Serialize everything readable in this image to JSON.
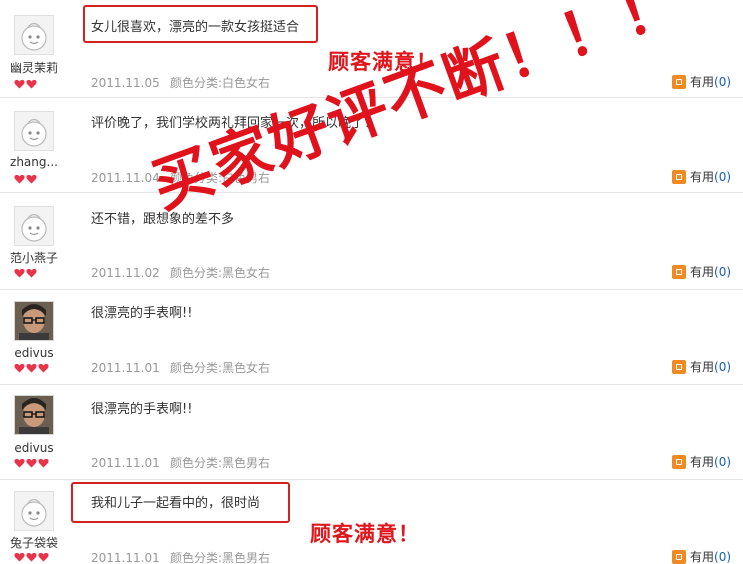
{
  "useful_label": "有用",
  "reviews": [
    {
      "user": "幽灵茉莉",
      "comment": "女儿很喜欢，漂亮的一款女孩挺适合",
      "date": "2011.11.05",
      "variant": "颜色分类:白色女右",
      "useful_count": "(0)",
      "avatar": "default-avatar",
      "hearts": 2
    },
    {
      "user": "zhang...",
      "comment": "评价晚了，我们学校两礼拜回家一次，所以晚了！",
      "date": "2011.11.04",
      "variant": "颜色分类:白色男右",
      "useful_count": "(0)",
      "avatar": "default-avatar",
      "hearts": 2
    },
    {
      "user": "范小燕子",
      "comment": "还不错，跟想象的差不多",
      "date": "2011.11.02",
      "variant": "颜色分类:黑色女右",
      "useful_count": "(0)",
      "avatar": "default-avatar",
      "hearts": 2
    },
    {
      "user": "edivus",
      "comment": "很漂亮的手表啊!!",
      "date": "2011.11.01",
      "variant": "颜色分类:黑色女右",
      "useful_count": "(0)",
      "avatar": "photo-avatar",
      "hearts": 3
    },
    {
      "user": "edivus",
      "comment": "很漂亮的手表啊!!",
      "date": "2011.11.01",
      "variant": "颜色分类:黑色男右",
      "useful_count": "(0)",
      "avatar": "photo-avatar",
      "hearts": 3
    },
    {
      "user": "兔子袋袋",
      "comment": "我和儿子一起看中的，很时尚",
      "date": "2011.11.01",
      "variant": "颜色分类:黑色男右",
      "useful_count": "(0)",
      "avatar": "default-avatar",
      "hearts": 3
    }
  ],
  "annotations": {
    "satisfied_top": "顾客满意！",
    "satisfied_bottom": "顾客满意！",
    "stamp": "买家好评不断！！！"
  },
  "colors": {
    "annotation_red": "#e0161d",
    "heart_red": "#e8344a",
    "link_blue": "#1a5fb4",
    "icon_orange": "#f08a24"
  }
}
